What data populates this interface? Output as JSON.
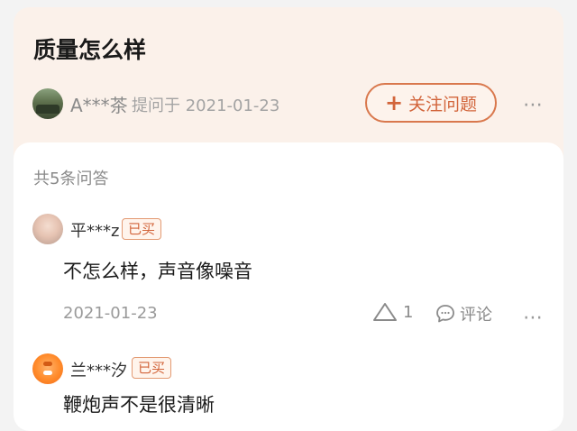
{
  "question": {
    "title": "质量怎么样",
    "asker_name": "A***茶",
    "ask_meta": "提问于 2021-01-23",
    "follow_label": "关注问题",
    "more_icon": "⋯"
  },
  "answers": {
    "count_label": "共5条问答",
    "items": [
      {
        "user": "平***z",
        "badge": "已买",
        "text": "不怎么样，声音像噪音",
        "date": "2021-01-23",
        "likes": "1",
        "comment_label": "评论"
      },
      {
        "user": "兰***汐",
        "badge": "已买",
        "text": "鞭炮声不是很清晰"
      }
    ]
  },
  "colors": {
    "accent": "#d2643a",
    "top_card_bg": "#fbf1ea"
  }
}
